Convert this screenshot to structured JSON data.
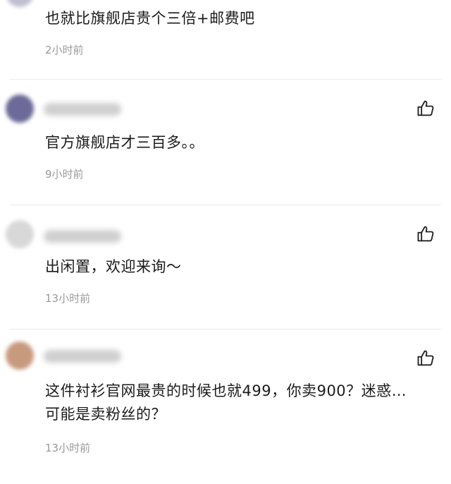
{
  "comments": [
    {
      "text": "也就比旗舰店贵个三倍+邮费吧",
      "time": "2小时前",
      "like_icon": "thumbs-up-icon"
    },
    {
      "text": "官方旗舰店才三百多。。",
      "time": "9小时前",
      "like_icon": "thumbs-up-icon",
      "avatar_color": "#6b6a98"
    },
    {
      "text": "出闲置，欢迎来询～",
      "time": "13小时前",
      "like_icon": "thumbs-up-icon",
      "avatar_color": "#d8d8d8"
    },
    {
      "text": "这件衬衫官网最贵的时候也就499，你卖900？迷惑…可能是卖粉丝的？",
      "time": "13小时前",
      "like_icon": "thumbs-up-icon",
      "avatar_color": "#c79a7e"
    }
  ]
}
